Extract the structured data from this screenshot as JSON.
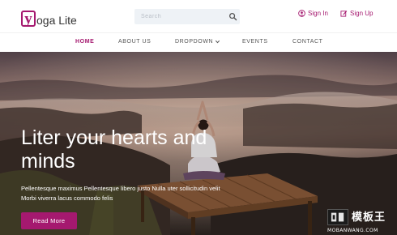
{
  "brand": {
    "mark": "y",
    "rest": "oga Lite"
  },
  "search": {
    "placeholder": "Search"
  },
  "auth": {
    "sign_in": "Sign In",
    "sign_up": "Sign Up"
  },
  "nav": {
    "home": "HOME",
    "about": "ABOUT US",
    "dropdown": "DROPDOWN",
    "events": "EVENTS",
    "contact": "CONTACT"
  },
  "hero": {
    "title": "Liter your hearts and minds",
    "text": "Pellentesque maximus Pellentesque libero justo Nulla uter sollicitudin velit Morbi viverra lacus commodo felis",
    "button": "Read More"
  },
  "watermark": {
    "brand": "模板王",
    "url": "MOBANWANG.COM"
  },
  "colors": {
    "accent": "#a5196f",
    "text": "#555555",
    "search_bg": "#eef2f6"
  }
}
